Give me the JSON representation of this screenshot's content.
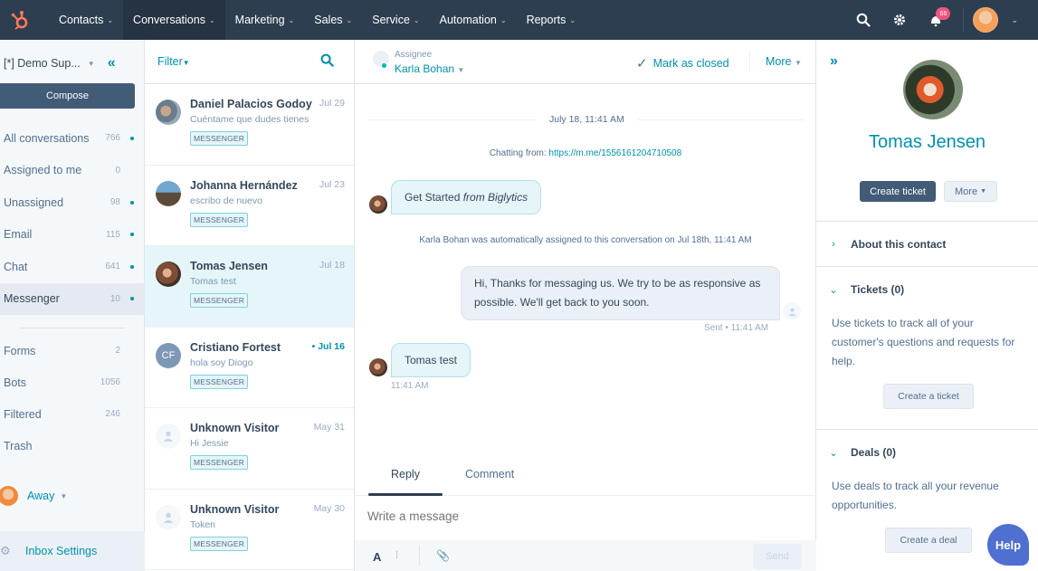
{
  "topnav": {
    "logo_icon": "hubspot-sprocket-icon",
    "items": [
      {
        "label": "Contacts",
        "active": false
      },
      {
        "label": "Conversations",
        "active": true
      },
      {
        "label": "Marketing",
        "active": false
      },
      {
        "label": "Sales",
        "active": false
      },
      {
        "label": "Service",
        "active": false
      },
      {
        "label": "Automation",
        "active": false
      },
      {
        "label": "Reports",
        "active": false
      }
    ],
    "notification_count": "66",
    "icons": [
      "search-icon",
      "gear-icon",
      "notification-bell-icon",
      "user-avatar",
      "chevron-down-icon"
    ]
  },
  "sidebar": {
    "inbox_name": "[*] Demo Sup...",
    "compose_label": "Compose",
    "items": [
      {
        "label": "All conversations",
        "count": "766",
        "dot": true
      },
      {
        "label": "Assigned to me",
        "count": "0",
        "dot": false
      },
      {
        "label": "Unassigned",
        "count": "98",
        "dot": true
      },
      {
        "label": "Email",
        "count": "115",
        "dot": true
      },
      {
        "label": "Chat",
        "count": "641",
        "dot": true
      },
      {
        "label": "Messenger",
        "count": "10",
        "dot": true,
        "active": true
      }
    ],
    "items2": [
      {
        "label": "Forms",
        "count": "2"
      },
      {
        "label": "Bots",
        "count": "1056"
      },
      {
        "label": "Filtered",
        "count": "246"
      },
      {
        "label": "Trash",
        "count": ""
      }
    ],
    "status_label": "Away",
    "settings_label": "Inbox Settings"
  },
  "convlist": {
    "filter_label": "Filter",
    "items": [
      {
        "name": "Daniel Palacios Godoy",
        "date": "Jul 29",
        "preview": "Cuéntame que dudes tienes",
        "channel": "MESSENGER",
        "unread": false
      },
      {
        "name": "Johanna Hernández",
        "date": "Jul 23",
        "preview": "escribo de nuevo",
        "channel": "MESSENGER",
        "unread": false
      },
      {
        "name": "Tomas Jensen",
        "date": "Jul 18",
        "preview": "Tomas test",
        "channel": "MESSENGER",
        "unread": false,
        "selected": true
      },
      {
        "name": "Cristiano Fortest",
        "initials": "CF",
        "date": "• Jul 16",
        "preview": "hola soy Diogo",
        "channel": "MESSENGER",
        "unread": true
      },
      {
        "name": "Unknown Visitor",
        "date": "May 31",
        "preview": "Hi Jessie",
        "channel": "MESSENGER",
        "unread": false
      },
      {
        "name": "Unknown Visitor",
        "date": "May 30",
        "preview": "Token",
        "channel": "MESSENGER",
        "unread": false
      }
    ]
  },
  "conversation": {
    "assignee_label": "Assignee",
    "assignee_name": "Karla Bohan",
    "mark_closed_label": "Mark as closed",
    "more_label": "More",
    "date_separator": "July 18, 11:41 AM",
    "chatting_from_label": "Chatting from:",
    "chatting_from_url": "https://m.me/1556161204710508",
    "messages": [
      {
        "direction": "in",
        "text": "Get Started",
        "suffix": "from Biglytics"
      },
      {
        "direction": "system",
        "text": "Karla Bohan was automatically assigned to this conversation on Jul 18th, 11:41 AM"
      },
      {
        "direction": "out",
        "text": "Hi, Thanks for messaging us. We try to be as responsive as possible. We'll get back to you soon.",
        "status": "Sent • 11:41 AM"
      },
      {
        "direction": "in",
        "text": "Tomas test",
        "time": "11:41 AM"
      }
    ],
    "tabs": [
      {
        "label": "Reply",
        "active": true
      },
      {
        "label": "Comment",
        "active": false
      }
    ],
    "composer_placeholder": "Write a message",
    "toolbar": {
      "format_label": "A",
      "send_label": "Send"
    }
  },
  "contact": {
    "name": "Tomas Jensen",
    "create_ticket_label": "Create ticket",
    "more_label": "More",
    "sections": [
      {
        "title": "About this contact",
        "expanded": false
      },
      {
        "title": "Tickets (0)",
        "expanded": true,
        "body": "Use tickets to track all of your customer's questions and requests for help.",
        "button": "Create a ticket"
      },
      {
        "title": "Deals (0)",
        "expanded": true,
        "body": "Use deals to track all your revenue opportunities.",
        "button": "Create a deal"
      }
    ]
  },
  "help_label": "Help",
  "colors": {
    "nav_bg": "#2d3e50",
    "accent": "#0091ae",
    "primary_button": "#425b76",
    "selected_row": "#e5f5f8",
    "help_button": "#4f6fd1",
    "badge": "#f2547d"
  }
}
